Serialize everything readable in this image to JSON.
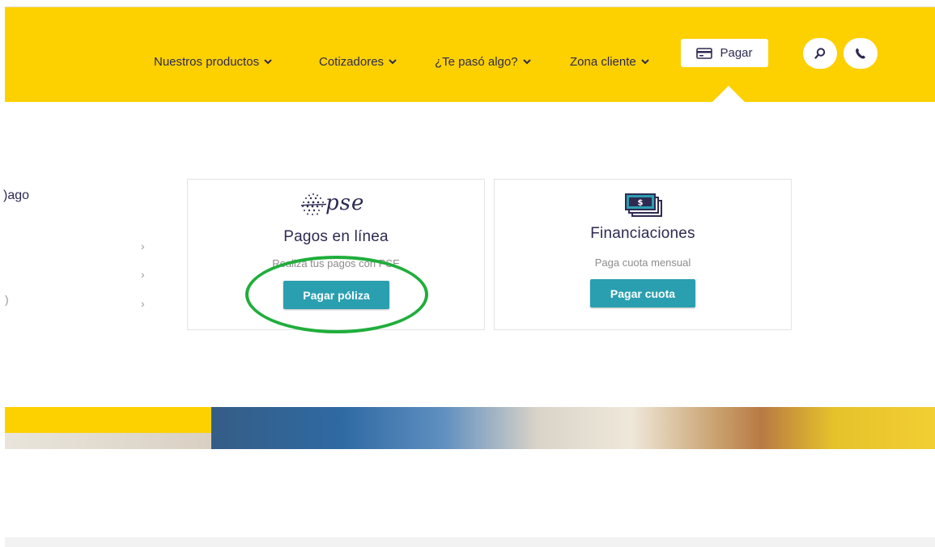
{
  "nav": {
    "items": [
      {
        "label": "Nuestros productos"
      },
      {
        "label": "Cotizadores"
      },
      {
        "label": "¿Te pasó algo?"
      },
      {
        "label": "Zona cliente"
      }
    ],
    "pay_label": "Pagar",
    "icons": [
      "chevron-down-icon",
      "credit-card-icon",
      "search-icon",
      "phone-icon"
    ]
  },
  "sidebar": {
    "heading_fragment": ")ago",
    "fragment_2": ")",
    "chevron": "›"
  },
  "cards": {
    "pse": {
      "logo_text": "pse",
      "title": "Pagos en línea",
      "subtitle": "Realiza tus pagos con PSE",
      "button": "Pagar póliza"
    },
    "financing": {
      "title": "Financiaciones",
      "subtitle": "Paga cuota mensual",
      "button": "Pagar cuota"
    }
  },
  "colors": {
    "brand_yellow": "#fdd000",
    "navy": "#2e2a52",
    "teal": "#2a9fb0",
    "annotation_green": "#1fae3b"
  }
}
